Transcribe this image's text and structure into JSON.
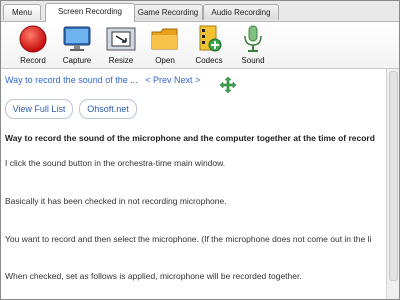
{
  "tabs": {
    "menu": "Menu",
    "items": [
      "Screen Recording",
      "Game Recording",
      "Audio Recording"
    ],
    "active": "Screen Recording"
  },
  "toolbar": {
    "tools": [
      {
        "label": "Record",
        "icon": "record-icon"
      },
      {
        "label": "Capture",
        "icon": "monitor-icon"
      },
      {
        "label": "Resize",
        "icon": "resize-icon"
      },
      {
        "label": "Open",
        "icon": "folder-icon"
      },
      {
        "label": "Codecs",
        "icon": "codecs-icon"
      },
      {
        "label": "Sound",
        "icon": "microphone-icon"
      }
    ]
  },
  "page": {
    "title_link": "Way to record the sound of the ...",
    "prev": "< Prev",
    "next": "Next >",
    "buttons": {
      "view_full_list": "View Full List",
      "ohsoft": "Ohsoft.net"
    },
    "heading": "Way to record the sound of the microphone and the computer together at the time of record",
    "paragraphs": [
      "I click the sound button in the orchestra-time main window.",
      "Basically it has been checked in not recording microphone.",
      "You want to record and then select the microphone. (If the microphone does not come out in the li",
      "When checked, set as follows is applied, microphone will be recorded together."
    ]
  },
  "colors": {
    "link": "#3366cc",
    "record_red": "#e02020",
    "tab_bg": "#e9e9e9"
  }
}
